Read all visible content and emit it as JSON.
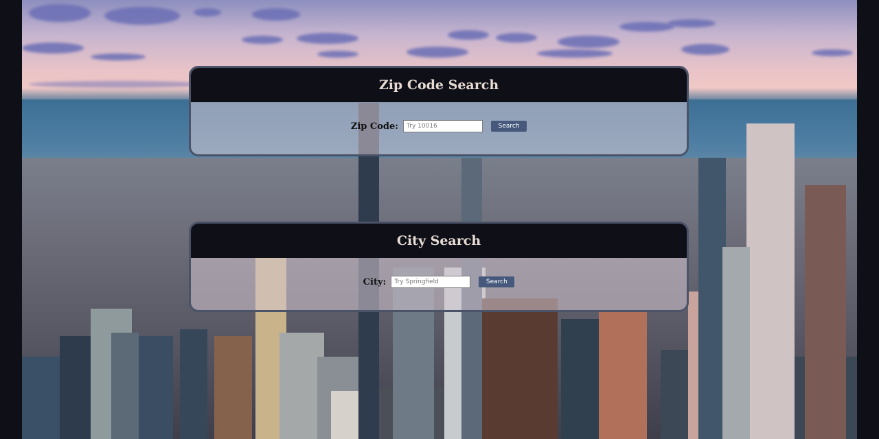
{
  "zip_search": {
    "title": "Zip Code Search",
    "label": "Zip Code:",
    "placeholder": "Try 10016",
    "value": "",
    "button_label": "Search"
  },
  "city_search": {
    "title": "City Search",
    "label": "City:",
    "placeholder": "Try Springfield",
    "value": "",
    "button_label": "Search"
  },
  "colors": {
    "header_bg": "#0e0f17",
    "header_text": "#e7dcd4",
    "button_bg": "#46597c",
    "panel_border": "#4a5368"
  }
}
